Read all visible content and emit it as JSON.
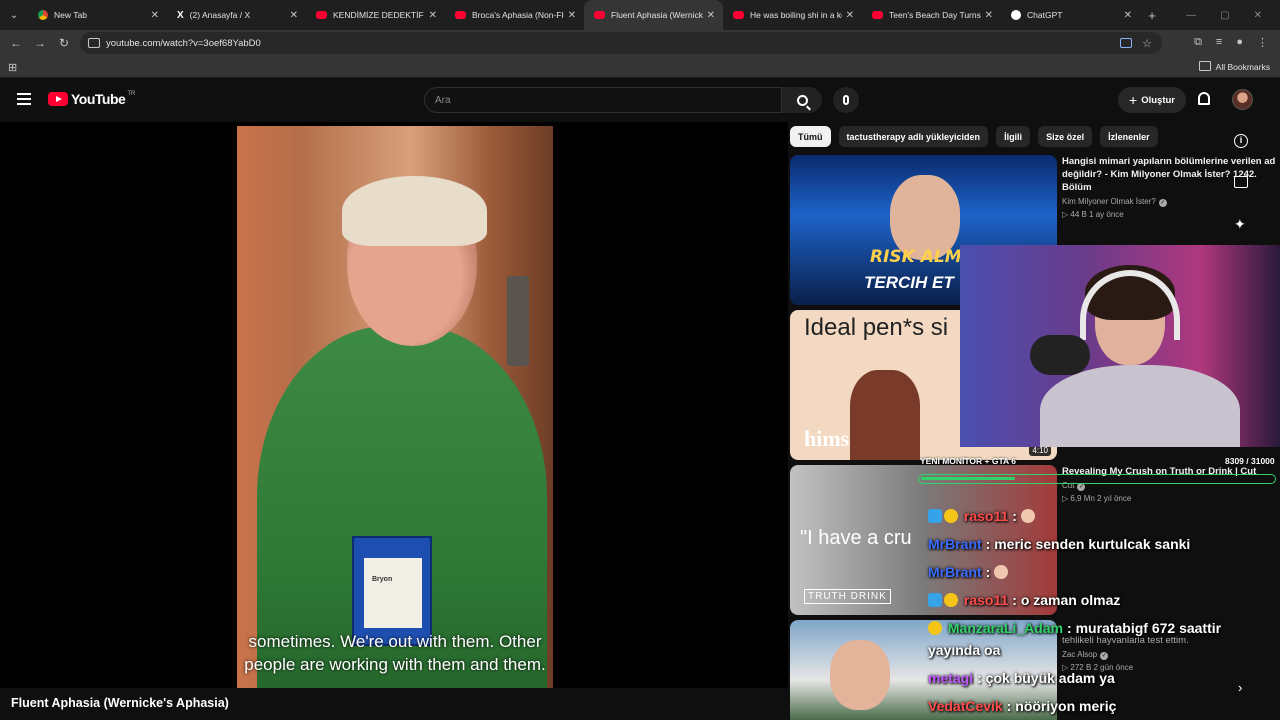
{
  "browser": {
    "tabs": [
      {
        "title": "New Tab",
        "icon": "chrome-icon",
        "active": false
      },
      {
        "title": "(2) Anasayfa / X",
        "icon": "x-icon",
        "active": false
      },
      {
        "title": "KENDİMİZE DEDEKTİF TU",
        "icon": "youtube-icon",
        "active": false
      },
      {
        "title": "Broca's Aphasia (Non-Flu",
        "icon": "youtube-icon",
        "active": false
      },
      {
        "title": "Fluent Aphasia (Wernicke",
        "icon": "youtube-icon",
        "active": true
      },
      {
        "title": "He was boiling shi in a ke",
        "icon": "youtube-icon",
        "active": false
      },
      {
        "title": "Teen's Beach Day Turns In",
        "icon": "youtube-icon",
        "active": false
      },
      {
        "title": "ChatGPT",
        "icon": "chatgpt-icon",
        "active": false
      }
    ],
    "url": "youtube.com/watch?v=3oef68YabD0",
    "all_bookmarks": "All Bookmarks"
  },
  "youtube": {
    "logo_text": "YouTube",
    "region": "TR",
    "search_placeholder": "Ara",
    "create_label": "Oluştur",
    "video_title": "Fluent Aphasia (Wernicke's Aphasia)",
    "subtitle_line1": "sometimes. We're out with them. Other",
    "subtitle_line2": "people are working with them and them.",
    "badge_name": "Bryon",
    "chips": [
      {
        "label": "Tümü",
        "active": true
      },
      {
        "label": "tactustherapy adlı yükleyiciden",
        "active": false
      },
      {
        "label": "İlgili",
        "active": false
      },
      {
        "label": "Size özel",
        "active": false
      },
      {
        "label": "İzlenenler",
        "active": false
      }
    ],
    "recommendations": [
      {
        "title": "Hangisi mimari yapıların bölümlerine verilen ad değildir? - Kim Milyoner Olmak İster? 1242. Bölüm",
        "channel": "Kim Milyoner Olmak İster?",
        "stats": "▷ 44 B   1 ay önce",
        "thumb_text1": "RISK ALMA",
        "thumb_text2": "TERCIH ET"
      },
      {
        "thumb_text1": "Ideal pen*s si",
        "thumb_text2": "hims",
        "duration": "4:10"
      },
      {
        "title": "Revealing My Crush on Truth or Drink | Cut",
        "channel": "Cut",
        "stats": "▷ 6,9 Mn   2 yıl önce",
        "thumb_text1": "\"I have a cru",
        "thumb_text2": "TRUTH DRINK"
      },
      {
        "title": "tehlikeli hayvanlarla test ettim.",
        "channel": "Zac Alsop",
        "stats": "▷ 272 B   2 gün önce"
      }
    ]
  },
  "stream_overlay": {
    "goal_label": "YENİ MONİTOR + GTA 6",
    "goal_count": "8309 / 31000",
    "goal_fraction": 0.268,
    "chat": [
      {
        "user": "raso11",
        "message": ":",
        "color": "#ff4d4d"
      },
      {
        "user": "MrBrant",
        "message": ": meric senden kurtulcak sanki",
        "color": "#3b6cff"
      },
      {
        "user": "MrBrant",
        "message": ":",
        "color": "#3b6cff"
      },
      {
        "user": "raso11",
        "message": ": o zaman olmaz",
        "color": "#ff4d4d"
      },
      {
        "user": "ManzaraLi_Adam",
        "message": ": muratabigf 672 saattir",
        "color": "#33d16a"
      },
      {
        "user": "",
        "message": "yayında oa",
        "color": "#ffffff"
      },
      {
        "user": "metagi",
        "message": ": çok büyük adam ya",
        "color": "#c05cff"
      },
      {
        "user": "VedatCevik",
        "message": ": nööriyon meriç",
        "color": "#ff4d4d"
      }
    ]
  }
}
